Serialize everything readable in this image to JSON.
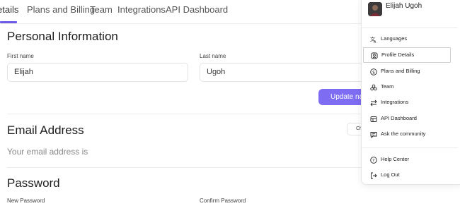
{
  "tabs": [
    {
      "label": "etails"
    },
    {
      "label": "Plans and Billing"
    },
    {
      "label": "Team"
    },
    {
      "label": "Integrations"
    },
    {
      "label": "API Dashboard"
    }
  ],
  "personal": {
    "title": "Personal Information",
    "first_name_label": "First name",
    "first_name_value": "Elijah",
    "last_name_label": "Last name",
    "last_name_value": "Ugoh",
    "update_button": "Update na"
  },
  "email": {
    "title": "Email Address",
    "text": "Your email address is",
    "change_button": "Ch"
  },
  "password": {
    "title": "Password",
    "new_label": "New Password",
    "confirm_label": "Confirm Password"
  },
  "menu": {
    "user_name": "Elijah Ugoh",
    "items": [
      {
        "label": "Languages",
        "icon": "translate-icon"
      },
      {
        "label": "Profile Details",
        "icon": "profile-icon"
      },
      {
        "label": "Plans and Billing",
        "icon": "dollar-icon"
      },
      {
        "label": "Team",
        "icon": "team-icon"
      },
      {
        "label": "Integrations",
        "icon": "arrows-icon"
      },
      {
        "label": "API Dashboard",
        "icon": "dashboard-icon"
      },
      {
        "label": "Ask the community",
        "icon": "chat-icon"
      },
      {
        "label": "Help Center",
        "icon": "help-icon"
      },
      {
        "label": "Log Out",
        "icon": "logout-icon"
      }
    ]
  },
  "colors": {
    "accent": "#7e6cf2",
    "tab_underline": "#6e5ce6"
  }
}
